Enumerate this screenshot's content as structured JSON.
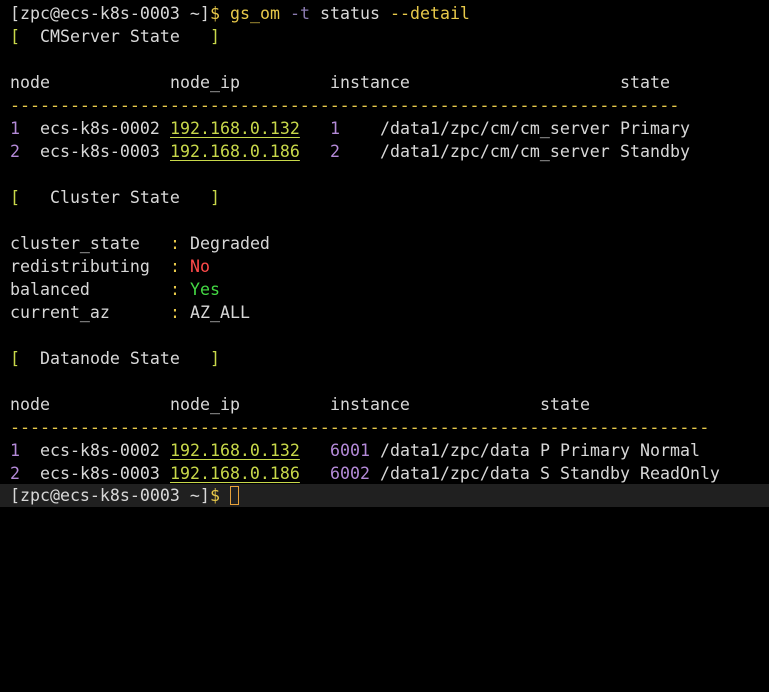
{
  "prompt": {
    "text": "[zpc@ecs-k8s-0003 ~]$ ",
    "text_plain": "[zpc@ecs-k8s-0003 ~]",
    "dollar": "$"
  },
  "command": {
    "program": "gs_om",
    "flag": "-t",
    "arg": "status",
    "option": "--detail"
  },
  "cmserver": {
    "header_open": "[",
    "title": "CMServer State",
    "header_close": "]",
    "columns": {
      "node": "node",
      "node_ip": "node_ip",
      "instance": "instance",
      "state": "state"
    },
    "separator": "-------------------------------------------------------------------",
    "rows": [
      {
        "idx": "1",
        "node": "ecs-k8s-0002",
        "ip": "192.168.0.132",
        "inst_id": "1",
        "inst_path": "/data1/zpc/cm/cm_server",
        "state": "Primary"
      },
      {
        "idx": "2",
        "node": "ecs-k8s-0003",
        "ip": "192.168.0.186",
        "inst_id": "2",
        "inst_path": "/data1/zpc/cm/cm_server",
        "state": "Standby"
      }
    ]
  },
  "cluster": {
    "header_open": "[",
    "title": "Cluster State",
    "header_close": "]",
    "items": [
      {
        "key": "cluster_state",
        "sep": ":",
        "value": "Degraded",
        "color": "#d8d8d8"
      },
      {
        "key": "redistributing",
        "sep": ":",
        "value": "No",
        "color": "#ff4a4a"
      },
      {
        "key": "balanced",
        "sep": ":",
        "value": "Yes",
        "color": "#44d844"
      },
      {
        "key": "current_az",
        "sep": ":",
        "value": "AZ_ALL",
        "color": "#d8d8d8"
      }
    ]
  },
  "datanode": {
    "header_open": "[",
    "title": "Datanode State",
    "header_close": "]",
    "columns": {
      "node": "node",
      "node_ip": "node_ip",
      "instance": "instance",
      "state": "state"
    },
    "separator": "----------------------------------------------------------------------",
    "rows": [
      {
        "idx": "1",
        "node": "ecs-k8s-0002",
        "ip": "192.168.0.132",
        "inst_id": "6001",
        "inst_path": "/data1/zpc/data",
        "role_flag": "P",
        "role": "Primary",
        "state": "Normal"
      },
      {
        "idx": "2",
        "node": "ecs-k8s-0003",
        "ip": "192.168.0.186",
        "inst_id": "6002",
        "inst_path": "/data1/zpc/data",
        "role_flag": "S",
        "role": "Standby",
        "state": "ReadOnly"
      }
    ]
  },
  "colors": {
    "background": "#000000",
    "text": "#d8d8d8",
    "prompt_dollar": "#e8a23a",
    "command": "#e8c94a",
    "ip": "#c8d84a",
    "index": "#b48ad8",
    "no": "#ff4a4a",
    "yes": "#44d844"
  },
  "icons": {
    "cursor": "block-cursor-icon"
  }
}
